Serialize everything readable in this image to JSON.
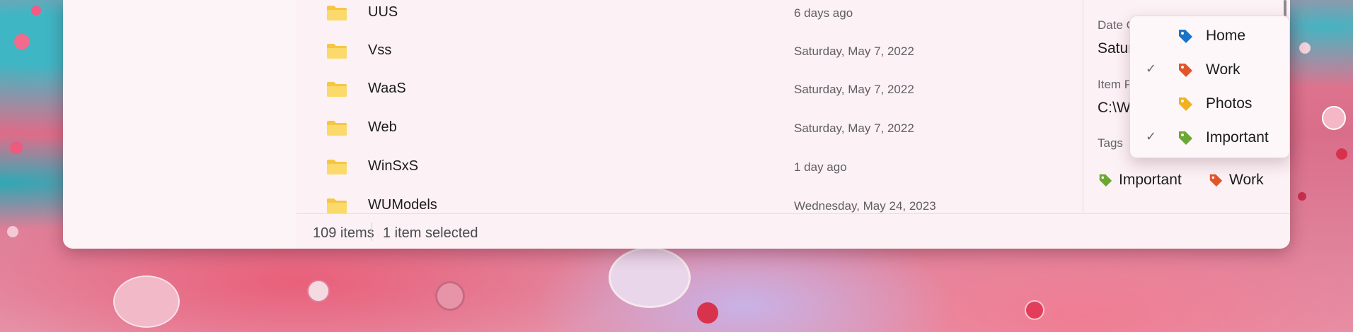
{
  "files": [
    {
      "name": "UUS",
      "date": "6 days ago"
    },
    {
      "name": "Vss",
      "date": "Saturday, May 7, 2022"
    },
    {
      "name": "WaaS",
      "date": "Saturday, May 7, 2022"
    },
    {
      "name": "Web",
      "date": "Saturday, May 7, 2022"
    },
    {
      "name": "WinSxS",
      "date": "1 day ago"
    },
    {
      "name": "WUModels",
      "date": "Wednesday, May 24, 2023"
    }
  ],
  "details": {
    "date_created_label": "Date Created",
    "date_created_value": "Saturday, May",
    "item_path_label": "Item Path",
    "item_path_value": "C:\\Windows\\Sp",
    "tags_label": "Tags",
    "tags": [
      {
        "label": "Important",
        "color": "#6aa832"
      },
      {
        "label": "Work",
        "color": "#e0562a"
      }
    ]
  },
  "status": {
    "item_count": "109 items",
    "selected": "1 item selected"
  },
  "tag_menu": {
    "items": [
      {
        "label": "Home",
        "color": "#1a73c8",
        "checked": false
      },
      {
        "label": "Work",
        "color": "#e0562a",
        "checked": true
      },
      {
        "label": "Photos",
        "color": "#f0b21e",
        "checked": false
      },
      {
        "label": "Important",
        "color": "#6aa832",
        "checked": true
      }
    ],
    "check_glyph": "✓"
  },
  "colors": {
    "folder": "#f6c643",
    "window_bg": "#fbeef3"
  }
}
